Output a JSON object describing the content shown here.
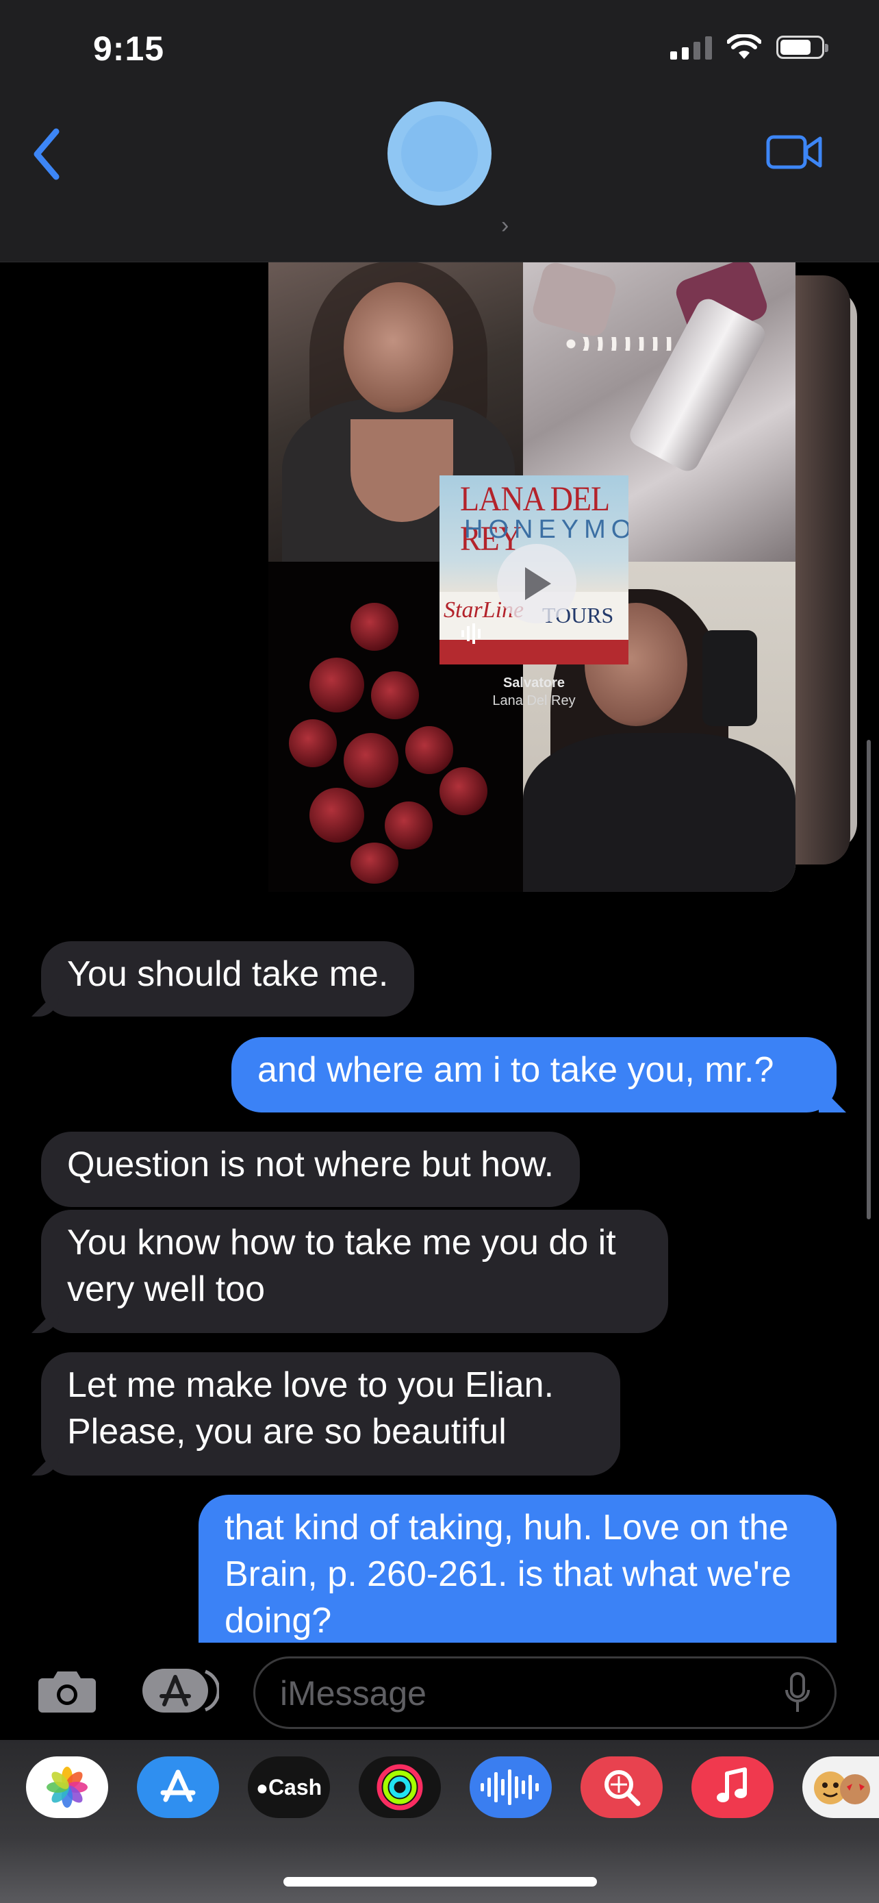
{
  "status_bar": {
    "time": "9:15"
  },
  "header": {
    "contact_chevron": "›"
  },
  "media": {
    "album_title": "LANA DEL REY",
    "album_subtitle": "HONEYMOON",
    "album_starline": "StarLine",
    "album_tours": "TOURS",
    "song_title": "Salvatore",
    "song_artist": "Lana Del Rey"
  },
  "messages": [
    {
      "direction": "in",
      "text": "You should take me."
    },
    {
      "direction": "out",
      "text": "and where am i to take you, mr.?"
    },
    {
      "direction": "in",
      "text": "Question is not where but how."
    },
    {
      "direction": "in",
      "text": "You know how to take me you do it very well too"
    },
    {
      "direction": "in",
      "text": "Let me make love to you Elian. Please, you are so beautiful"
    },
    {
      "direction": "out",
      "text": "that kind of taking, huh. Love on the Brain, p. 260-261. is that what we're doing?"
    }
  ],
  "input": {
    "placeholder": "iMessage"
  },
  "app_strip": {
    "apps": [
      {
        "name": "photos-icon"
      },
      {
        "name": "app-store-icon"
      },
      {
        "name": "apple-cash-icon",
        "label": "Cash"
      },
      {
        "name": "fitness-icon"
      },
      {
        "name": "audio-message-icon"
      },
      {
        "name": "images-search-icon"
      },
      {
        "name": "music-icon"
      },
      {
        "name": "memoji-icon"
      }
    ]
  },
  "colors": {
    "outgoing_bubble": "#3b82f6",
    "incoming_bubble": "#26252a",
    "accent": "#3d86f6"
  }
}
